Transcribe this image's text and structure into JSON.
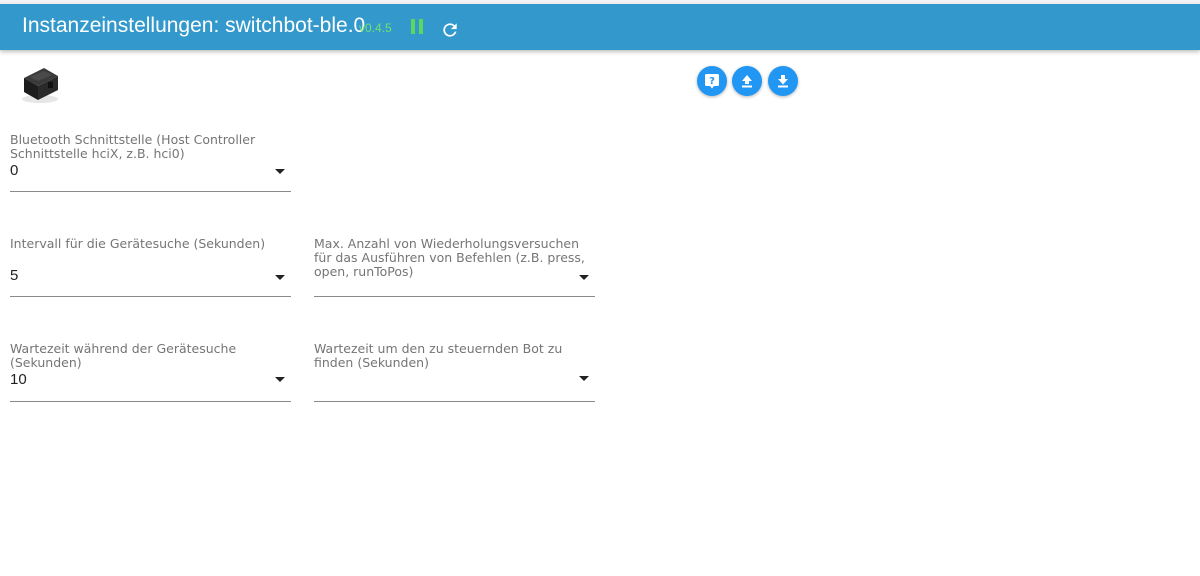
{
  "header": {
    "title": "Instanzeinstellungen: switchbot-ble.0",
    "version": "v0.4.5",
    "pause_icon": "pause-icon",
    "reload_icon": "reload-icon"
  },
  "toolbar": {
    "buttons": [
      {
        "icon": "help-icon"
      },
      {
        "icon": "upload-icon"
      },
      {
        "icon": "download-icon"
      }
    ]
  },
  "colors": {
    "header_bg": "#3399cc",
    "version": "#6fe06f",
    "pause": "#5cd65c",
    "button_bg": "#2196f3"
  },
  "fields": {
    "bluetooth_interface": {
      "label": "Bluetooth Schnittstelle (Host Controller Schnittstelle hciX, z.B. hci0)",
      "value": "0"
    },
    "scan_interval": {
      "label": "Intervall für die Gerätesuche (Sekunden)",
      "value": "5"
    },
    "max_retries": {
      "label": "Max. Anzahl von Wiederholungsversuchen für das Ausführen von Befehlen (z.B. press, open, runToPos)",
      "value": ""
    },
    "scan_wait": {
      "label": "Wartezeit während der Gerätesuche (Sekunden)",
      "value": "10"
    },
    "bot_wait": {
      "label": "Wartezeit um den zu steuernden Bot zu finden (Sekunden)",
      "value": ""
    }
  }
}
